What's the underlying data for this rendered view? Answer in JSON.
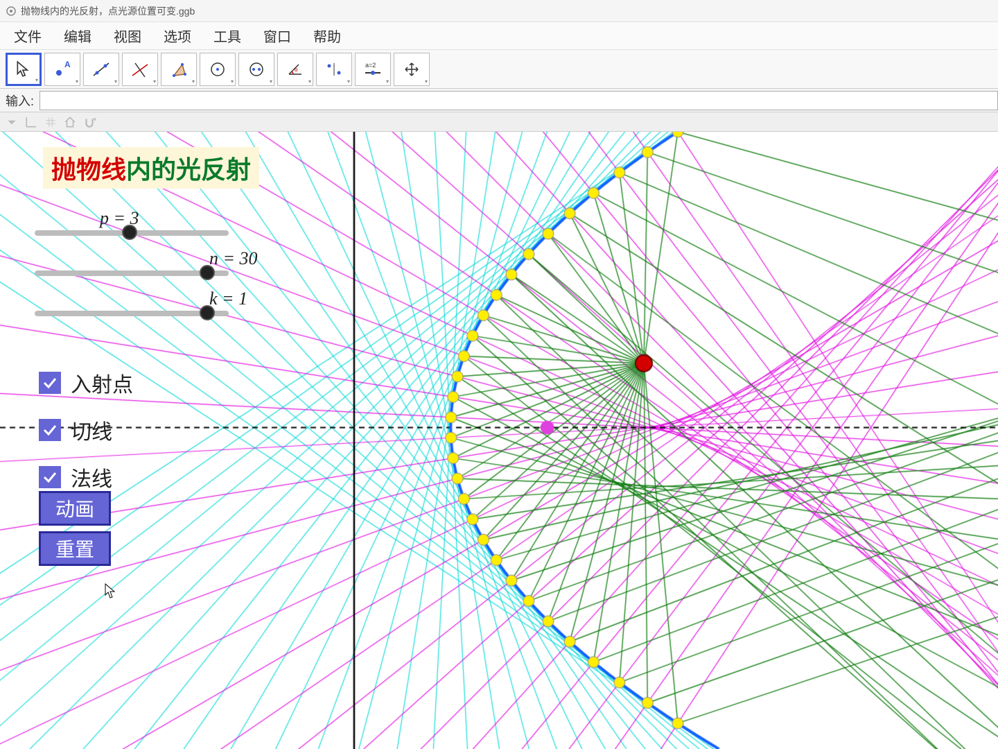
{
  "window": {
    "title": "抛物线内的光反射，点光源位置可变.ggb"
  },
  "menu": {
    "file": "文件",
    "edit": "编辑",
    "view": "视图",
    "options": "选项",
    "tools": "工具",
    "window": "窗口",
    "help": "帮助"
  },
  "input": {
    "label": "输入:",
    "value": ""
  },
  "title": {
    "red": "抛物线",
    "green": "内的光反射"
  },
  "sliders": {
    "p": {
      "label": "p = 3",
      "value": 3,
      "min": 0,
      "max": 10,
      "pos": 0.45
    },
    "n": {
      "label": "n = 30",
      "value": 30,
      "min": 0,
      "max": 30,
      "pos": 0.88
    },
    "k": {
      "label": "k = 1",
      "value": 1,
      "min": 0,
      "max": 1,
      "pos": 0.88
    }
  },
  "checkboxes": {
    "incident": {
      "label": "入射点",
      "checked": true
    },
    "tangent": {
      "label": "切线",
      "checked": true
    },
    "normal": {
      "label": "法线",
      "checked": true
    }
  },
  "buttons": {
    "animate": "动画",
    "reset": "重置"
  },
  "chart_data": {
    "type": "scatter",
    "description": "Parabola y²=2px with p=3, axis at x=0, directrix visible as vertical black line. Light source (red dot) inside parabola near (3,1). Focus (magenta dot) at (1.5,0). 30 yellow incidence points on parabola. Cyan tangent lines, magenta normal/reflected lines, green reflected rays.",
    "params": {
      "p": 3,
      "n": 30,
      "k": 1
    },
    "source_point": {
      "x": 3.0,
      "y": 1.0,
      "color": "#d40000"
    },
    "focus_point": {
      "x": 1.5,
      "y": 0,
      "color": "#e040e0"
    },
    "viewport": {
      "xmin": -7,
      "xmax": 8.5,
      "ymin": -5,
      "ymax": 4.6
    },
    "colors": {
      "tangent": "#00d8d8",
      "normal": "#e000e0",
      "reflected": "#0a7a0a",
      "parabola": "#1560ff",
      "points": "#ffee00"
    }
  }
}
